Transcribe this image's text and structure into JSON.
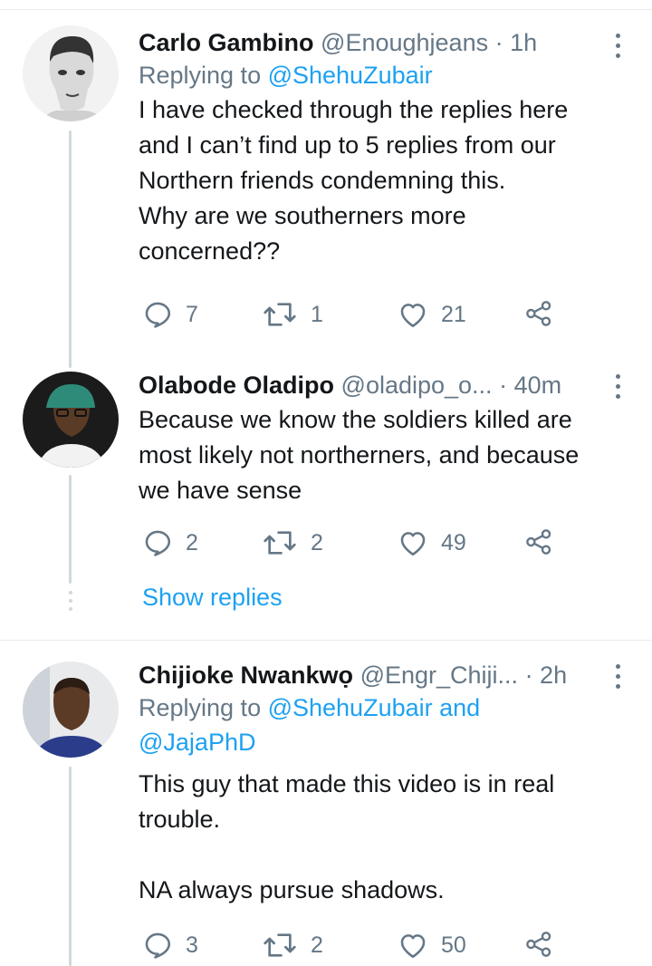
{
  "tweets": [
    {
      "name": "Carlo Gambino",
      "handle": "@Enoughjeans",
      "time": "· 1h",
      "replying_prefix": "Replying to ",
      "replying_to": "@ShehuZubair",
      "text": "I have checked through the replies here\nand I can’t find up to 5 replies from our\nNorthern friends condemning this.\nWhy are we southerners more\nconcerned??",
      "replies": "7",
      "retweets": "1",
      "likes": "21",
      "avatar_icon": "avatar-photo"
    },
    {
      "name": "Olabode Oladipo",
      "handle": "@oladipo_o...",
      "time": "· 40m",
      "text": "Because we know the soldiers killed  are\nmost likely not northerners, and because\nwe have sense",
      "replies": "2",
      "retweets": "2",
      "likes": "49",
      "avatar_icon": "avatar-photo"
    },
    {
      "name": "Chijioke Nwankwọ",
      "handle": "@Engr_Chiji...",
      "time": "· 2h",
      "replying_prefix": "Replying to ",
      "replying_to": "@ShehuZubair and\n@JajaPhD",
      "text": "This guy that made this video is in real\ntrouble.\n\nNA always pursue shadows.",
      "replies": "3",
      "retweets": "2",
      "likes": "50",
      "avatar_icon": "avatar-photo"
    }
  ],
  "show_replies": "Show replies",
  "icons": {
    "reply": "reply-icon",
    "retweet": "retweet-icon",
    "like": "like-icon",
    "share": "share-icon",
    "more": "more-vertical-icon"
  },
  "colors": {
    "link": "#1da1f2",
    "secondary": "#657786",
    "text": "#14171a",
    "thread_line": "#cfd9de"
  }
}
